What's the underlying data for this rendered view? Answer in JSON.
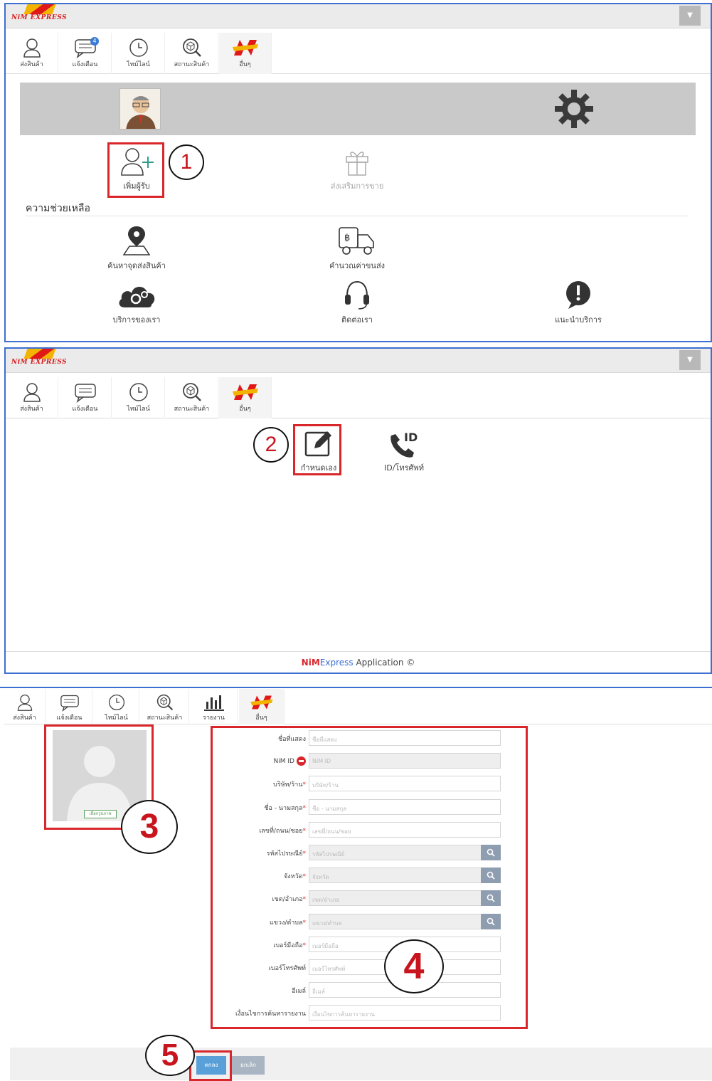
{
  "brand": {
    "logo_text": "NiM EXPRESS",
    "footer_nim": "NiM",
    "footer_express": "Express",
    "footer_rest": " Application ©"
  },
  "tabs": [
    {
      "label": "ส่งสินค้า",
      "icon": "user-icon"
    },
    {
      "label": "แจ้งเตือน",
      "icon": "message-icon"
    },
    {
      "label": "ไทม์ไลน์",
      "icon": "clock-icon"
    },
    {
      "label": "สถานะสินค้า",
      "icon": "box-search-icon"
    },
    {
      "label": "รายงาน",
      "icon": "bar-chart-icon"
    },
    {
      "label": "อื่นๆ",
      "icon": "nim-logo-icon"
    }
  ],
  "notification_count": "4",
  "panel1": {
    "add_receiver": "เพิ่มผู้รับ",
    "promo": "ส่งเสริมการขาย",
    "help_title": "ความช่วยเหลือ",
    "help_items": [
      "ค้นหาจุดส่งสินค้า",
      "คำนวณค่าขนส่ง",
      "บริการของเรา",
      "ติดต่อเรา",
      "แนะนำบริการ"
    ]
  },
  "panel2": {
    "custom": "กำหนดเอง",
    "id_phone": "ID/โทรศัพท์"
  },
  "panel3": {
    "choose_photo": "เลือกรูปภาพ",
    "fields": [
      {
        "label": "ชื่อที่แสดง",
        "placeholder": "ชื่อที่แสดง",
        "req": "",
        "search": false,
        "disabled": false
      },
      {
        "label": "NiM ID",
        "placeholder": "NiM ID",
        "req": "",
        "search": false,
        "disabled": true
      },
      {
        "label": "บริษัท/ร้าน",
        "placeholder": "บริษัท/ร้าน",
        "req": "*",
        "search": false,
        "disabled": false
      },
      {
        "label": "ชื่อ - นามสกุล",
        "placeholder": "ชื่อ - นามสกุล",
        "req": "*",
        "search": false,
        "disabled": false
      },
      {
        "label": "เลขที่/ถนน/ซอย",
        "placeholder": "เลขที่/ถนน/ซอย",
        "req": "*",
        "search": false,
        "disabled": false
      },
      {
        "label": "รหัสไปรษณีย์",
        "placeholder": "รหัสไปรษณีย์",
        "req": "*",
        "search": true,
        "disabled": true
      },
      {
        "label": "จังหวัด",
        "placeholder": "จังหวัด",
        "req": "*",
        "search": true,
        "disabled": true
      },
      {
        "label": "เขต/อำเภอ",
        "placeholder": "เขต/อำเภอ",
        "req": "*",
        "search": true,
        "disabled": true
      },
      {
        "label": "แขวง/ตำบล",
        "placeholder": "แขวง/ตำบล",
        "req": "*",
        "search": true,
        "disabled": true
      },
      {
        "label": "เบอร์มือถือ",
        "placeholder": "เบอร์มือถือ",
        "req": "*",
        "search": false,
        "disabled": false
      },
      {
        "label": "เบอร์โทรศัพท์",
        "placeholder": "เบอร์โทรศัพท์",
        "req": "",
        "search": false,
        "disabled": false
      },
      {
        "label": "อีเมล์",
        "placeholder": "อีเมล์",
        "req": "",
        "search": false,
        "disabled": false
      },
      {
        "label": "เงื่อนไขการค้นหารายงาน",
        "placeholder": "เงื่อนไขการค้นหารายงาน",
        "req": "",
        "search": false,
        "disabled": false
      }
    ],
    "ok": "ตกลง",
    "cancel": "ยกเลิก"
  },
  "steps": [
    "1",
    "2",
    "3",
    "4",
    "5"
  ],
  "colors": {
    "accent": "#3d6fd0",
    "highlight": "#d9262b",
    "ok_button": "#5aa0d8",
    "cancel_button": "#a9b5c2"
  }
}
